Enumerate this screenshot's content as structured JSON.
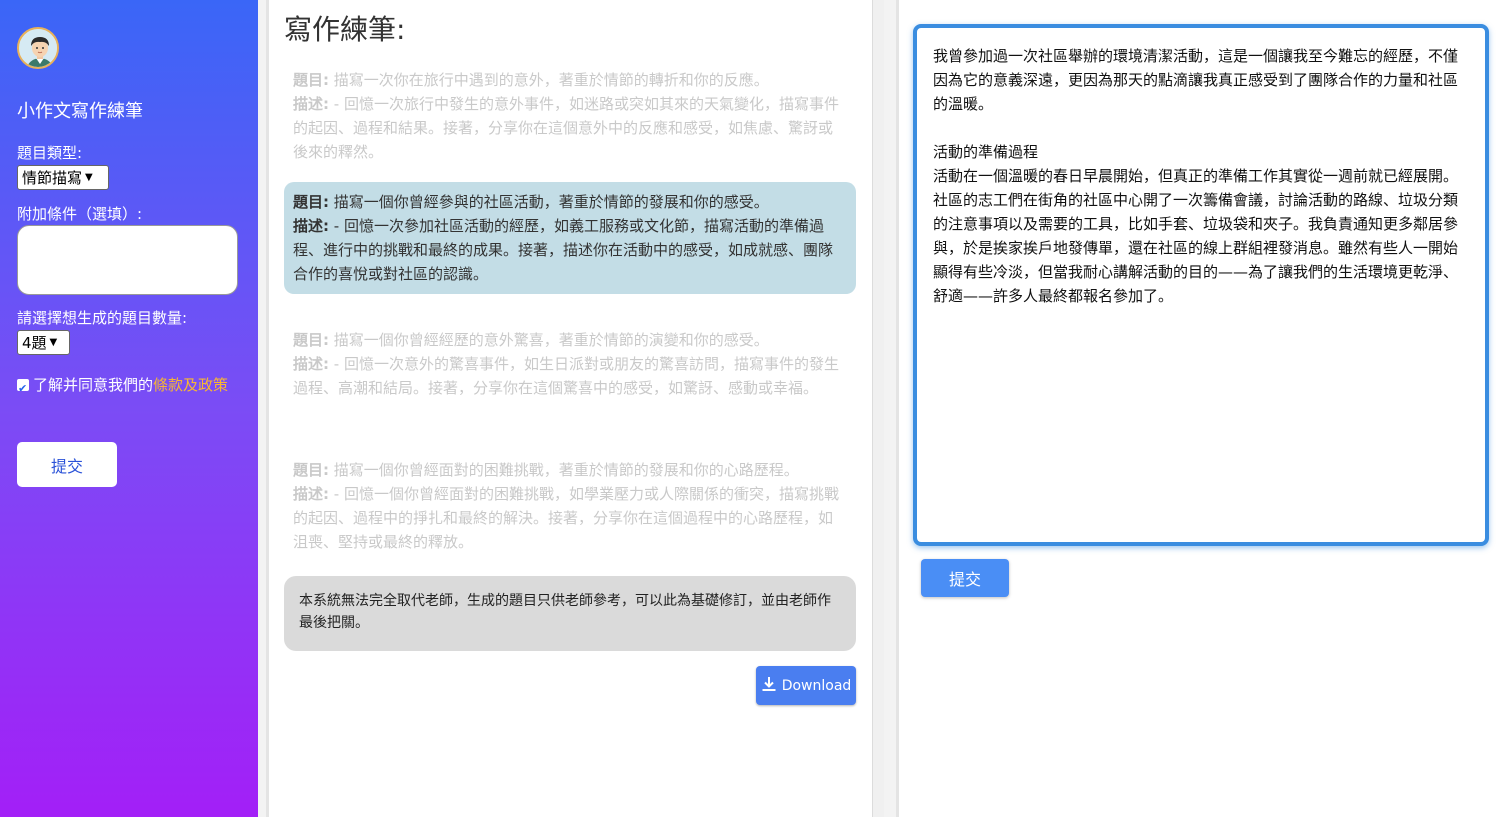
{
  "sidebar": {
    "app_title": "小作文寫作練筆",
    "topic_type_label": "題目類型:",
    "topic_type_value": "情節描寫",
    "extra_label": "附加條件（選填）:",
    "count_label": "請選擇想生成的題目數量:",
    "count_value": "4題",
    "terms_text": "了解并同意我們的",
    "terms_link": "條款及政策",
    "submit": "提交"
  },
  "middle": {
    "heading": "寫作練筆:",
    "questions": [
      {
        "topic_label": "題目:",
        "topic": "描寫一次你在旅行中遇到的意外，著重於情節的轉折和你的反應。",
        "desc_label": "描述:",
        "desc": "- 回憶一次旅行中發生的意外事件，如迷路或突如其來的天氣變化，描寫事件的起因、過程和結果。接著，分享你在這個意外中的反應和感受，如焦慮、驚訝或後來的釋然。"
      },
      {
        "topic_label": "題目:",
        "topic": "描寫一個你曾經參與的社區活動，著重於情節的發展和你的感受。",
        "desc_label": "描述:",
        "desc": "- 回憶一次參加社區活動的經歷，如義工服務或文化節，描寫活動的準備過程、進行中的挑戰和最終的成果。接著，描述你在活動中的感受，如成就感、團隊合作的喜悅或對社區的認識。"
      },
      {
        "topic_label": "題目:",
        "topic": "描寫一個你曾經經歷的意外驚喜，著重於情節的演變和你的感受。",
        "desc_label": "描述:",
        "desc": "- 回憶一次意外的驚喜事件，如生日派對或朋友的驚喜訪問，描寫事件的發生過程、高潮和結局。接著，分享你在這個驚喜中的感受，如驚訝、感動或幸福。"
      },
      {
        "topic_label": "題目:",
        "topic": "描寫一個你曾經面對的困難挑戰，著重於情節的發展和你的心路歷程。",
        "desc_label": "描述:",
        "desc": "- 回憶一個你曾經面對的困難挑戰，如學業壓力或人際關係的衝突，描寫挑戰的起因、過程中的掙扎和最終的解決。接著，分享你在這個過程中的心路歷程，如沮喪、堅持或最終的釋放。"
      }
    ],
    "note": "本系統無法完全取代老師，生成的題目只供老師參考，可以此為基礎修訂，並由老師作最後把關。",
    "download": "Download"
  },
  "right": {
    "essay": "我曾參加過一次社區舉辦的環境清潔活動，這是一個讓我至今難忘的經歷，不僅因為它的意義深遠，更因為那天的點滴讓我真正感受到了團隊合作的力量和社區的溫暖。\n\n活動的準備過程\n活動在一個溫暖的春日早晨開始，但真正的準備工作其實從一週前就已經展開。社區的志工們在街角的社區中心開了一次籌備會議，討論活動的路線、垃圾分類的注意事項以及需要的工具，比如手套、垃圾袋和夾子。我負責通知更多鄰居參與，於是挨家挨戶地發傳單，還在社區的線上群組裡發消息。雖然有些人一開始顯得有些冷淡，但當我耐心講解活動的目的——為了讓我們的生活環境更乾淨、舒適——許多人最終都報名參加了。",
    "submit": "提交"
  },
  "colors": {
    "sidebar_top": "#3a66f7",
    "sidebar_bottom": "#a31ff7",
    "active_question_bg": "#c3dde6",
    "terms_link": "#f7b733",
    "editor_border": "#3a8de0",
    "primary_button": "#4a8ef5"
  },
  "icons": {
    "avatar": "user-avatar",
    "download": "download-icon",
    "select_arrow": "chevron-down-icon"
  }
}
